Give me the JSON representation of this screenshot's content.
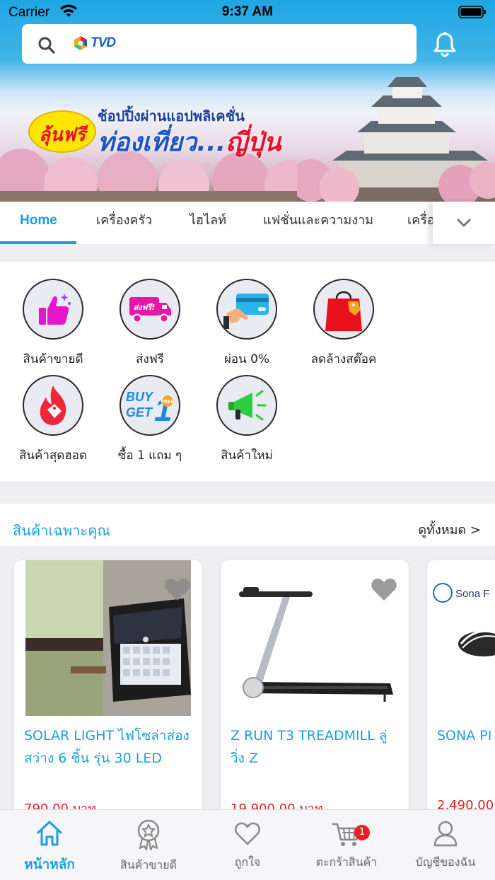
{
  "status_bar": {
    "carrier": "Carrier",
    "time": "9:37 AM"
  },
  "search": {
    "logo_text": "TVD"
  },
  "banner": {
    "badge": "ลุ้นฟรี",
    "line1": "ช้อปปิ้งผ่านแอปพลิเคชั่น",
    "line2_a": "ท่องเที่ยว...",
    "line2_b": "ญี่ปุ่น"
  },
  "tabs": [
    "Home",
    "เครื่องครัว",
    "ไฮไลท์",
    "แฟชั่นและความงาม",
    "เครื่อ"
  ],
  "categories": [
    {
      "label": "สินค้าขายดี",
      "icon": "thumbs-up-icon"
    },
    {
      "label": "ส่งฟรี",
      "icon": "delivery-truck-icon"
    },
    {
      "label": "ผ่อน 0%",
      "icon": "credit-card-icon"
    },
    {
      "label": "ลดล้างสต๊อค",
      "icon": "shopping-bag-icon"
    },
    {
      "label": "สินค้าสุดฮอต",
      "icon": "fire-tag-icon"
    },
    {
      "label": "ซื้อ 1 แถม ๆ",
      "icon": "buy-one-get-one-icon"
    },
    {
      "label": "สินค้าใหม่",
      "icon": "megaphone-icon"
    }
  ],
  "buy_get": {
    "buy": "BUY",
    "get": "GET",
    "one": "1",
    "free": "FREE"
  },
  "truck_label": "ส่งฟรี!",
  "featured": {
    "title": "สินค้าเฉพาะคุณ",
    "see_all": "ดูทั้งหมด >",
    "products": [
      {
        "name": "SOLAR LIGHT ไฟโซล่าส่องสว่าง 6 ชิ้น รุ่น 30 LED",
        "price": "790.00 บาท"
      },
      {
        "name": "Z RUN T3 TREADMILL ลู่วิ่ง Z",
        "price": "19,900.00 บาท"
      },
      {
        "name": "SONA PI สบาย",
        "price": "2,490.00",
        "brand": "Sona F"
      }
    ]
  },
  "nav": {
    "items": [
      {
        "label": "หน้าหลัก",
        "icon": "home-icon"
      },
      {
        "label": "สินค้าขายดี",
        "icon": "award-icon"
      },
      {
        "label": "ถูกใจ",
        "icon": "heart-icon"
      },
      {
        "label": "ตะกร้าสินค้า",
        "icon": "cart-icon"
      },
      {
        "label": "บัญชีของฉัน",
        "icon": "user-icon"
      }
    ],
    "cart_count": "1"
  },
  "colors": {
    "accent": "#1a9fe0",
    "price": "#e0201e",
    "badge": "#e8202a"
  }
}
